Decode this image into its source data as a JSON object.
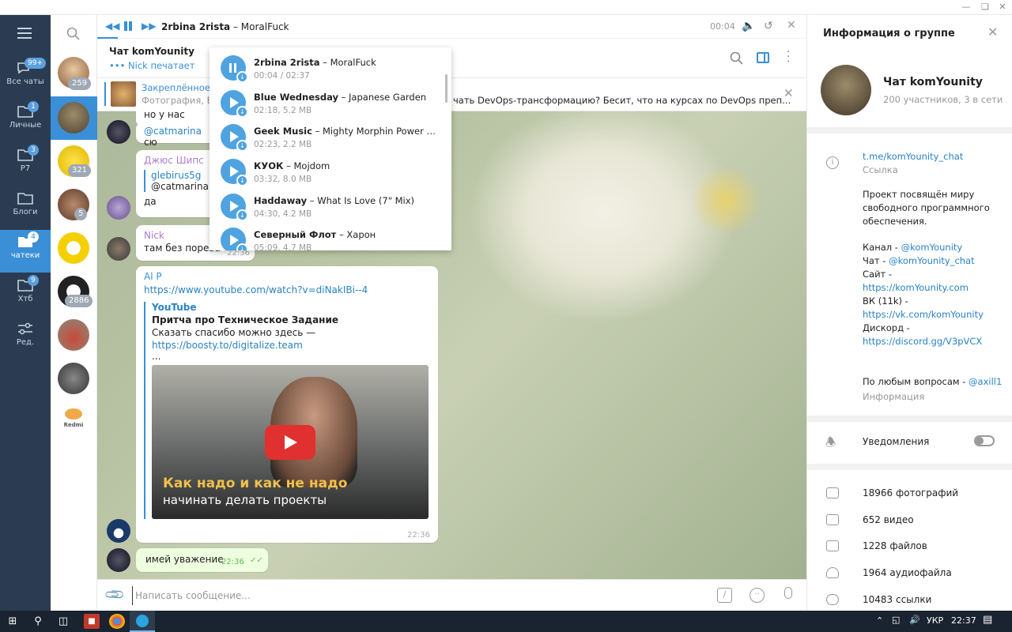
{
  "player": {
    "artist": "2rbina 2rista",
    "title": " – MoralFuck",
    "time": "00:04"
  },
  "chat": {
    "title": "Чат komYounity",
    "status": "Nick печатает"
  },
  "pinned": {
    "label": "Закреплённое с",
    "preview_prefix": "Фотография, Бе",
    "preview_text": "чать DevOps-трансформацию?  Бесит, что на курсах по DevOps преп..."
  },
  "folders": [
    {
      "label": "Все чаты",
      "badge": "99+",
      "icon": "chat-bubbles-icon"
    },
    {
      "label": "Личные",
      "badge": "1",
      "icon": "folder-icon"
    },
    {
      "label": "P7",
      "badge": "3",
      "icon": "folder-icon"
    },
    {
      "label": "Блоги",
      "badge": "",
      "icon": "folder-icon"
    },
    {
      "label": "чатеки",
      "badge": "4",
      "icon": "folder-icon"
    },
    {
      "label": "Хтб",
      "badge": "9",
      "icon": "folder-icon"
    },
    {
      "label": "Ред.",
      "badge": "",
      "icon": "sliders-icon"
    }
  ],
  "chatlist_badges": [
    "259",
    "321",
    "5",
    "2886"
  ],
  "redmi_label": "Redmi",
  "playlist": [
    {
      "artist": "2rbina 2rista",
      "title": " – MoralFuck",
      "sub": "00:04 / 02:37"
    },
    {
      "artist": "Blue Wednesday",
      "title": " – Japanese Garden",
      "sub": "02:18, 5.2 MB"
    },
    {
      "artist": "Geek Music",
      "title": " – Mighty Morphin Power Rang...",
      "sub": "02:23, 2.2 MB"
    },
    {
      "artist": "КУОК",
      "title": " – Mojdom",
      "sub": "03:32, 8.0 MB"
    },
    {
      "artist": "Haddaway",
      "title": " – What Is Love (7\" Mix)",
      "sub": "04:30, 4.2 MB"
    },
    {
      "artist": "Северный Флот",
      "title": " – Харон",
      "sub": "05:09, 4.7 MB"
    }
  ],
  "messages": {
    "m1_text": "но у нас кром",
    "m2_mention": "@catmarina",
    "m2_text": " сю",
    "m3_author": "Джюс Шипс",
    "m3_reply_name": "glebirus5g",
    "m3_reply_text": "@catmarina с",
    "m3_text": "да",
    "m4_author": "Nick",
    "m4_text": "там без порева",
    "m4_time": "22:36",
    "m5_author": "Al P",
    "m5_link": "https://www.youtube.com/watch?v=diNakIBi--4",
    "m5_site": "YouTube",
    "m5_title": "Притча про Техническое Задание",
    "m5_desc": "Сказать спасибо можно здесь —",
    "m5_desc_link": "https://boosty.to/digitalize.team",
    "m5_more": "...",
    "m5_thumb_line1": "Как надо и как не надо",
    "m5_thumb_line2": "начинать делать проекты",
    "m5_time": "22:36",
    "m6_text": "имей уважение",
    "m6_time": "22:36"
  },
  "composer": {
    "placeholder": "Написать сообщение..."
  },
  "info": {
    "header": "Информация о группе",
    "group_name": "Чат komYounity",
    "group_sub": "200 участников, 3 в сети",
    "link": "t.me/komYounity_chat",
    "link_label": "Ссылка",
    "description": "Проект посвящён миру свободного программного обеспечения.",
    "channel_label": "Канал - ",
    "channel": "@komYounity",
    "chat_label": "Чат - ",
    "chat": "@komYounity_chat",
    "site_label": "Сайт -",
    "site": "https://komYounity.com",
    "vk_label": "ВК (11k) -",
    "vk": "https://vk.com/komYounity",
    "discord_label": "Дискорд -",
    "discord": "https://discord.gg/V3pVCX",
    "questions": "По любым вопросам - ",
    "questions_mention": "@axill1",
    "questions_label": "Информация",
    "notifications": "Уведомления",
    "media": [
      {
        "label": "18966 фотографий",
        "icon": "photo-icon"
      },
      {
        "label": "652 видео",
        "icon": "video-icon"
      },
      {
        "label": "1228 файлов",
        "icon": "file-icon"
      },
      {
        "label": "1964 аудиофайла",
        "icon": "headphones-icon"
      },
      {
        "label": "10483 ссылки",
        "icon": "link-icon"
      }
    ]
  },
  "taskbar": {
    "lang": "УКР",
    "time": "22:37"
  },
  "colors": {
    "accent": "#3a8fd6",
    "sidebar": "#2b3c52",
    "link": "#2a82c3"
  }
}
